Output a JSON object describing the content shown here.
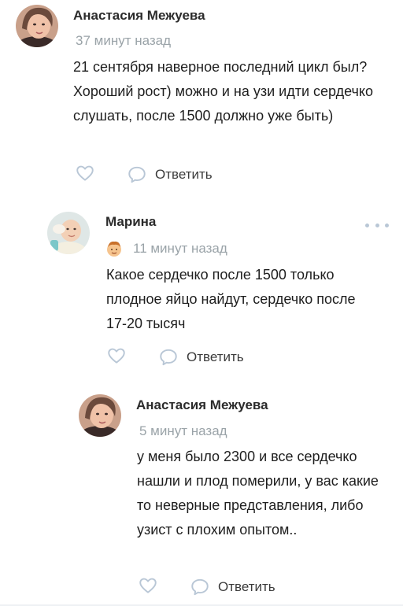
{
  "comments": [
    {
      "author": "Анастасия Межуева",
      "time": "37 минут назад",
      "text": "21 сентября наверное последний цикл был? Хороший рост) можно и на узи идти сердечко слушать, после 1500 должно уже быть)",
      "reply_label": "Ответить"
    },
    {
      "author": "Марина",
      "time": "11 минут назад",
      "text": "Какое сердечко после 1500 только плодное яйцо найдут, сердечко после 17-20 тысяч",
      "reply_label": "Ответить"
    },
    {
      "author": "Анастасия Межуева",
      "time": "5 минут назад",
      "text": "у меня было 2300 и все сердечко нашли и плод померили, у вас какие то неверные представления, либо узист с плохим опытом..",
      "reply_label": "Ответить"
    }
  ],
  "icons": {
    "like": "heart-outline-icon",
    "reply": "speech-bubble-icon",
    "more": "more-dots-icon",
    "badge": "boy-face-badge-icon"
  },
  "colors": {
    "icon": "#b9c7d6",
    "time": "#9aa3a8",
    "text": "#1e1e1e"
  }
}
